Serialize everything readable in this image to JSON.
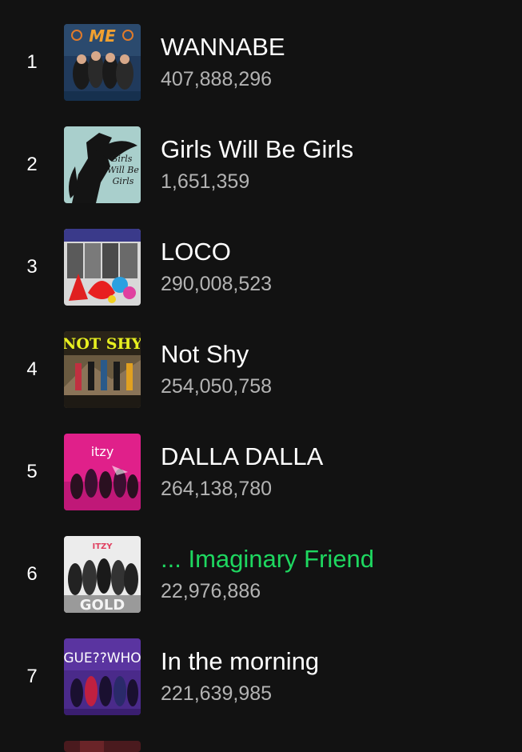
{
  "tracks": [
    {
      "rank": "1",
      "title": "WANNABE",
      "plays": "407,888,296",
      "art": "wannabe-cover"
    },
    {
      "rank": "2",
      "title": "Girls Will Be Girls",
      "plays": "1,651,359",
      "art": "girls-will-be-girls-cover"
    },
    {
      "rank": "3",
      "title": "LOCO",
      "plays": "290,008,523",
      "art": "loco-cover"
    },
    {
      "rank": "4",
      "title": "Not Shy",
      "plays": "254,050,758",
      "art": "not-shy-cover"
    },
    {
      "rank": "5",
      "title": "DALLA DALLA",
      "plays": "264,138,780",
      "art": "dalla-dalla-cover"
    },
    {
      "rank": "6",
      "title": "... Imaginary Friend",
      "plays": "22,976,886",
      "art": "gold-cover",
      "playing": true
    },
    {
      "rank": "7",
      "title": "In the morning",
      "plays": "221,639,985",
      "art": "guess-who-cover"
    }
  ],
  "colors": {
    "background": "#121212",
    "text": "#ffffff",
    "secondary": "#b3b3b3",
    "playing": "#1ed760"
  }
}
